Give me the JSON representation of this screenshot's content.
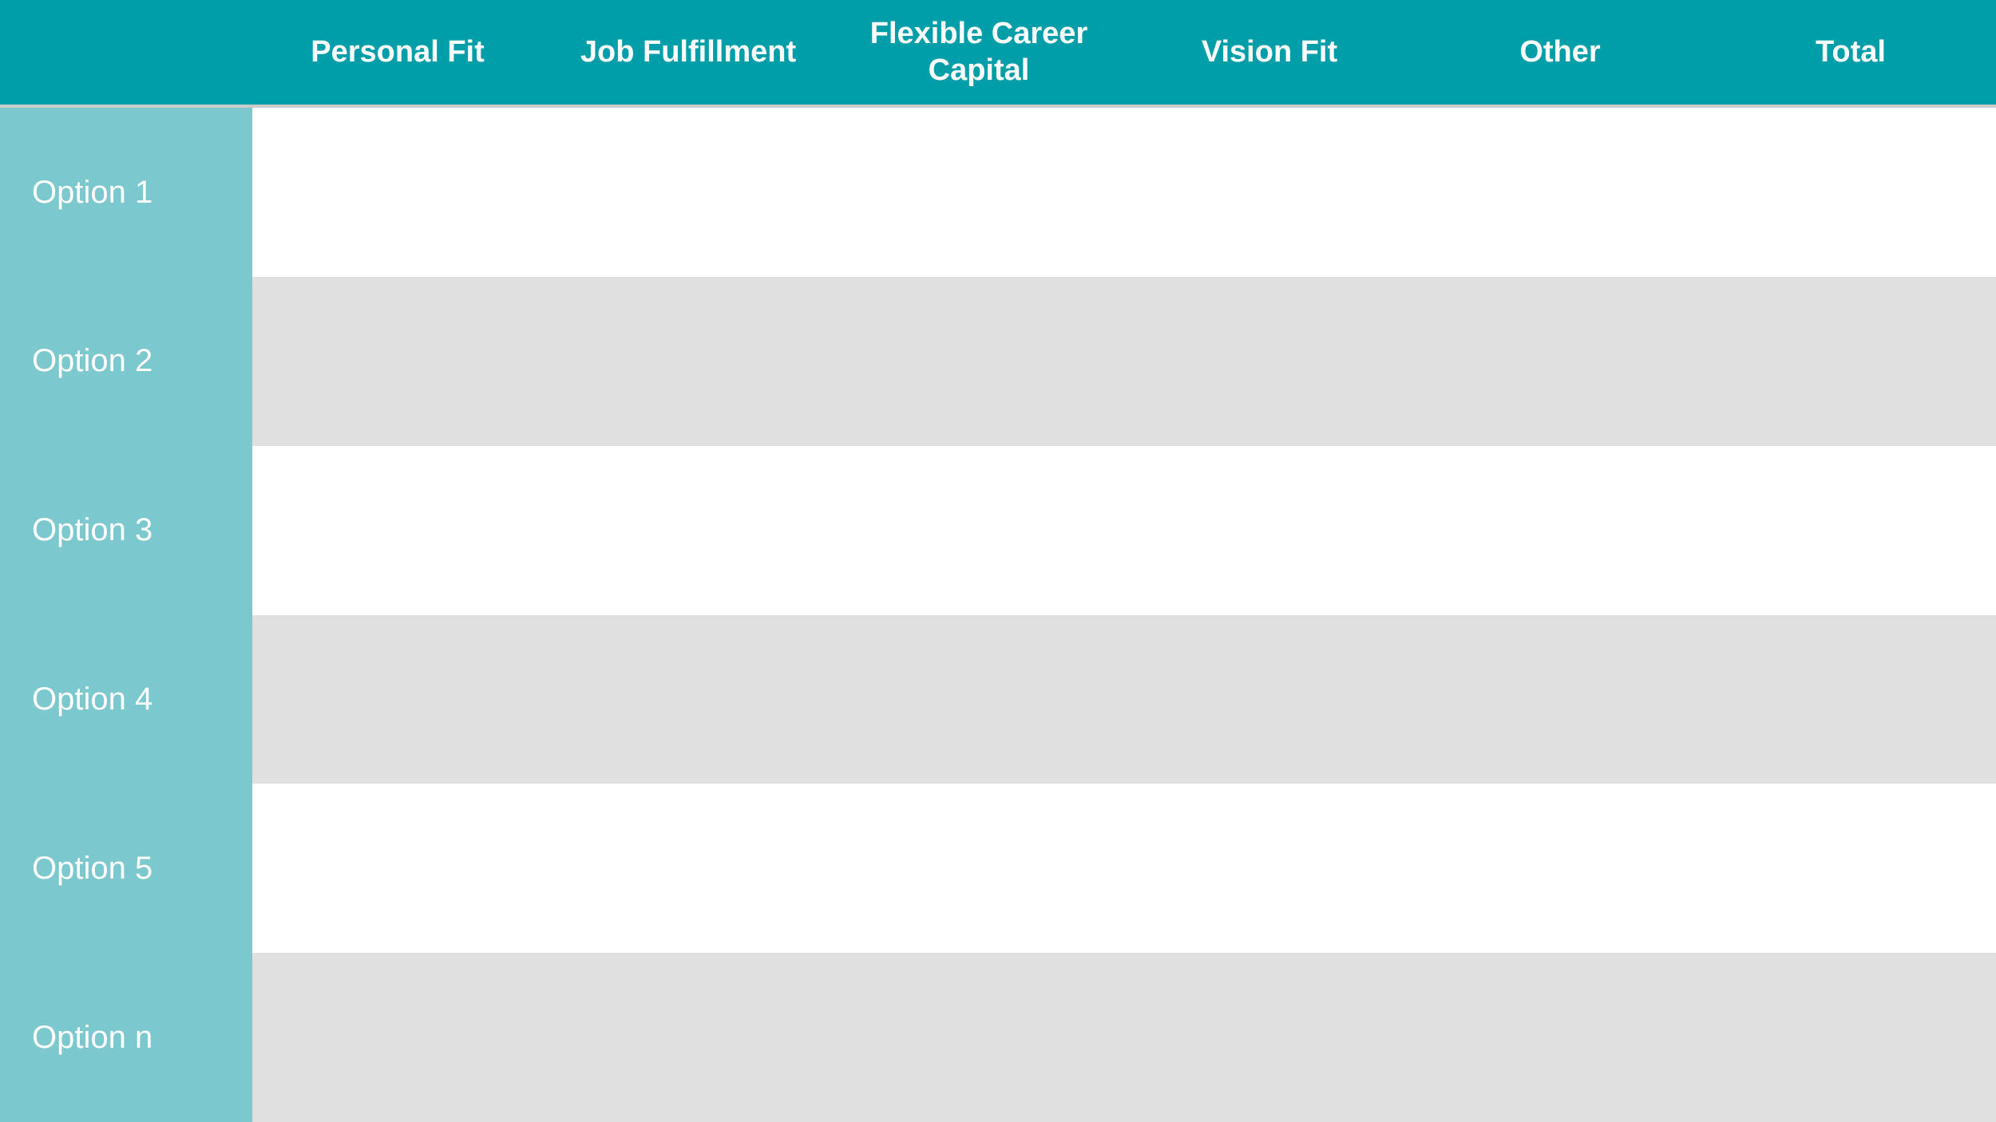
{
  "header": {
    "columns": [
      {
        "label": "",
        "key": "empty"
      },
      {
        "label": "Personal Fit",
        "key": "personal-fit"
      },
      {
        "label": "Job Fulfillment",
        "key": "job-fulfillment"
      },
      {
        "label": "Flexible Career Capital",
        "key": "flexible-career-capital"
      },
      {
        "label": "Vision Fit",
        "key": "vision-fit"
      },
      {
        "label": "Other",
        "key": "other"
      },
      {
        "label": "Total",
        "key": "total"
      }
    ]
  },
  "rows": [
    {
      "label": "Option 1",
      "key": "option-1"
    },
    {
      "label": "Option 2",
      "key": "option-2"
    },
    {
      "label": "Option 3",
      "key": "option-3"
    },
    {
      "label": "Option 4",
      "key": "option-4"
    },
    {
      "label": "Option 5",
      "key": "option-5"
    },
    {
      "label": "Option n",
      "key": "option-n"
    }
  ],
  "colors": {
    "header_bg": "#009ea8",
    "sidebar_bg": "#7bc8cf",
    "row_even_bg": "#e0e0e0",
    "row_odd_bg": "#ffffff",
    "header_text": "#ffffff",
    "sidebar_text": "#ffffff"
  }
}
